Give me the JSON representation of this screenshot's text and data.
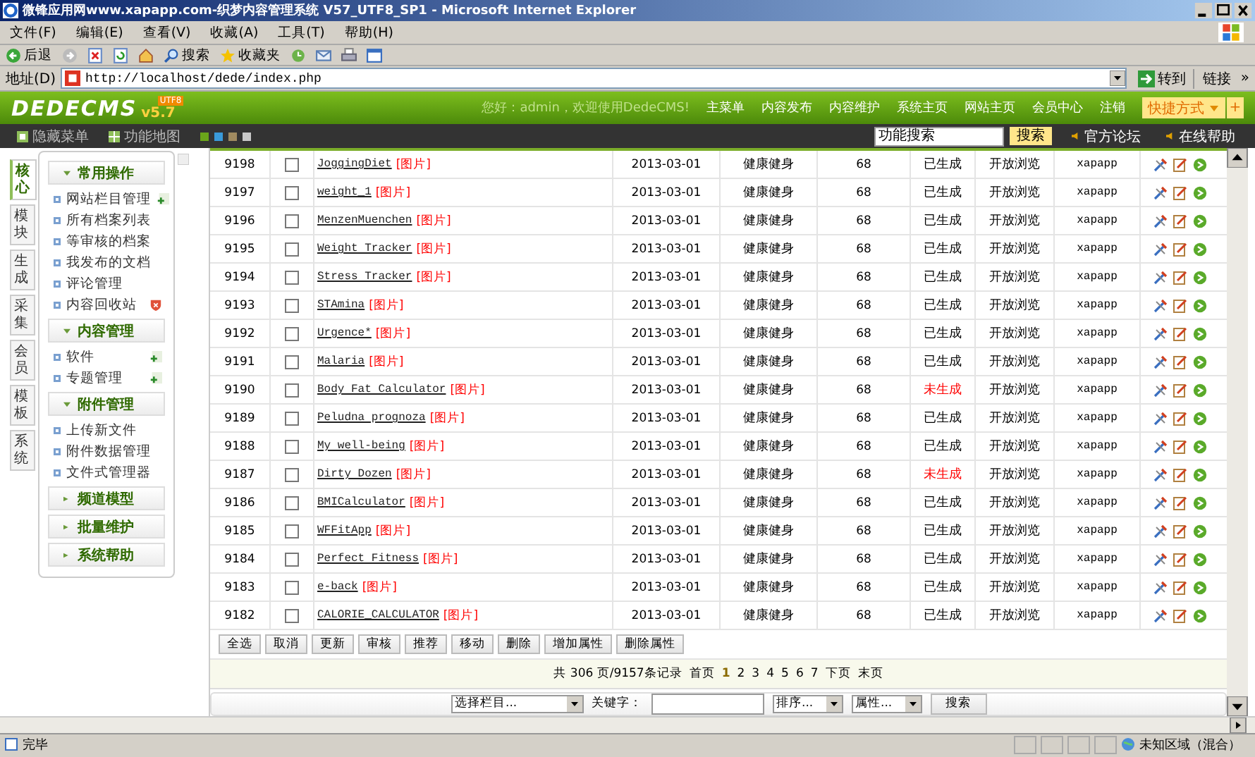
{
  "window": {
    "title": "微锋应用网www.xapapp.com-织梦内容管理系统 V57_UTF8_SP1 - Microsoft Internet Explorer"
  },
  "menu": [
    "文件(F)",
    "编辑(E)",
    "查看(V)",
    "收藏(A)",
    "工具(T)",
    "帮助(H)"
  ],
  "toolbar": [
    {
      "kind": "back",
      "label": "后退"
    },
    {
      "kind": "forward"
    },
    {
      "kind": "stop"
    },
    {
      "kind": "refresh"
    },
    {
      "kind": "home"
    },
    {
      "kind": "search",
      "label": "搜索"
    },
    {
      "kind": "favorites",
      "label": "收藏夹"
    },
    {
      "kind": "history"
    },
    {
      "kind": "mail"
    },
    {
      "kind": "print"
    },
    {
      "kind": "edit"
    }
  ],
  "address": {
    "label": "地址(D)",
    "url": "http://localhost/dede/index.php",
    "go": "转到",
    "links": "链接",
    "more": "»"
  },
  "header": {
    "logo": "DEDECMS",
    "version": "v5.7",
    "badge": "UTF8",
    "greeting": "您好：admin，欢迎使用DedeCMS!",
    "nav": [
      "主菜单",
      "内容发布",
      "内容维护",
      "系统主页",
      "网站主页",
      "会员中心",
      "注销"
    ],
    "shortcut": "快捷方式",
    "add": "+"
  },
  "subbar": {
    "hide_menu": "隐藏菜单",
    "map": "功能地图",
    "skins": [
      {
        "color": "#6aa51a"
      },
      {
        "color": "#3a9ad9"
      },
      {
        "color": "#a08a60"
      },
      {
        "color": "#c8c8c8"
      }
    ],
    "search_value": "功能搜索",
    "search_button": "搜索",
    "links": [
      "官方论坛",
      "在线帮助"
    ]
  },
  "sidebar": {
    "tabs": [
      {
        "label": "核心",
        "selected": true
      },
      {
        "label": "模块",
        "selected": false
      },
      {
        "label": "生成",
        "selected": false
      },
      {
        "label": "采集",
        "selected": false
      },
      {
        "label": "会员",
        "selected": false
      },
      {
        "label": "模板",
        "selected": false
      },
      {
        "label": "系统",
        "selected": false
      }
    ],
    "groups": [
      {
        "title": "常用操作",
        "expanded": true,
        "items": [
          {
            "label": "网站栏目管理",
            "kind": "add"
          },
          {
            "label": "所有档案列表",
            "kind": "plain"
          },
          {
            "label": "等审核的档案",
            "kind": "plain"
          },
          {
            "label": "我发布的文档",
            "kind": "plain"
          },
          {
            "label": "评论管理",
            "kind": "plain"
          },
          {
            "label": "内容回收站",
            "kind": "bin"
          }
        ]
      },
      {
        "title": "内容管理",
        "expanded": true,
        "items": [
          {
            "label": "软件",
            "kind": "add"
          },
          {
            "label": "专题管理",
            "kind": "add"
          }
        ]
      },
      {
        "title": "附件管理",
        "expanded": true,
        "items": [
          {
            "label": "上传新文件",
            "kind": "plain"
          },
          {
            "label": "附件数据管理",
            "kind": "plain"
          },
          {
            "label": "文件式管理器",
            "kind": "plain"
          }
        ]
      },
      {
        "title": "频道模型",
        "expanded": false
      },
      {
        "title": "批量维护",
        "expanded": false
      },
      {
        "title": "系统帮助",
        "expanded": false
      }
    ]
  },
  "table": {
    "rows": [
      {
        "id": "9198",
        "checked": false,
        "title": "JoggingDiet",
        "tag": "[图片]",
        "date": "2013-03-01",
        "category": "健康健身",
        "count": "68",
        "status": "已生成",
        "generated": true,
        "access": "开放浏览",
        "author": "xapapp"
      },
      {
        "id": "9197",
        "checked": false,
        "title": "weight_1",
        "tag": "[图片]",
        "date": "2013-03-01",
        "category": "健康健身",
        "count": "68",
        "status": "已生成",
        "generated": true,
        "access": "开放浏览",
        "author": "xapapp"
      },
      {
        "id": "9196",
        "checked": false,
        "title": "MenzenMuenchen",
        "tag": "[图片]",
        "date": "2013-03-01",
        "category": "健康健身",
        "count": "68",
        "status": "已生成",
        "generated": true,
        "access": "开放浏览",
        "author": "xapapp"
      },
      {
        "id": "9195",
        "checked": false,
        "title": "Weight Tracker",
        "tag": "[图片]",
        "date": "2013-03-01",
        "category": "健康健身",
        "count": "68",
        "status": "已生成",
        "generated": true,
        "access": "开放浏览",
        "author": "xapapp"
      },
      {
        "id": "9194",
        "checked": false,
        "title": "Stress Tracker",
        "tag": "[图片]",
        "date": "2013-03-01",
        "category": "健康健身",
        "count": "68",
        "status": "已生成",
        "generated": true,
        "access": "开放浏览",
        "author": "xapapp"
      },
      {
        "id": "9193",
        "checked": false,
        "title": "STAmina",
        "tag": "[图片]",
        "date": "2013-03-01",
        "category": "健康健身",
        "count": "68",
        "status": "已生成",
        "generated": true,
        "access": "开放浏览",
        "author": "xapapp"
      },
      {
        "id": "9192",
        "checked": false,
        "title": "Urgence*",
        "tag": "[图片]",
        "date": "2013-03-01",
        "category": "健康健身",
        "count": "68",
        "status": "已生成",
        "generated": true,
        "access": "开放浏览",
        "author": "xapapp"
      },
      {
        "id": "9191",
        "checked": false,
        "title": "Malaria",
        "tag": "[图片]",
        "date": "2013-03-01",
        "category": "健康健身",
        "count": "68",
        "status": "已生成",
        "generated": true,
        "access": "开放浏览",
        "author": "xapapp"
      },
      {
        "id": "9190",
        "checked": false,
        "title": "Body Fat Calculator",
        "tag": "[图片]",
        "date": "2013-03-01",
        "category": "健康健身",
        "count": "68",
        "status": "未生成",
        "generated": false,
        "access": "开放浏览",
        "author": "xapapp"
      },
      {
        "id": "9189",
        "checked": false,
        "title": "Peludna prognoza",
        "tag": "[图片]",
        "date": "2013-03-01",
        "category": "健康健身",
        "count": "68",
        "status": "已生成",
        "generated": true,
        "access": "开放浏览",
        "author": "xapapp"
      },
      {
        "id": "9188",
        "checked": false,
        "title": "My well-being",
        "tag": "[图片]",
        "date": "2013-03-01",
        "category": "健康健身",
        "count": "68",
        "status": "已生成",
        "generated": true,
        "access": "开放浏览",
        "author": "xapapp"
      },
      {
        "id": "9187",
        "checked": false,
        "title": "Dirty Dozen",
        "tag": "[图片]",
        "date": "2013-03-01",
        "category": "健康健身",
        "count": "68",
        "status": "未生成",
        "generated": false,
        "access": "开放浏览",
        "author": "xapapp"
      },
      {
        "id": "9186",
        "checked": false,
        "title": "BMICalculator",
        "tag": "[图片]",
        "date": "2013-03-01",
        "category": "健康健身",
        "count": "68",
        "status": "已生成",
        "generated": true,
        "access": "开放浏览",
        "author": "xapapp"
      },
      {
        "id": "9185",
        "checked": false,
        "title": "WFFitApp",
        "tag": "[图片]",
        "date": "2013-03-01",
        "category": "健康健身",
        "count": "68",
        "status": "已生成",
        "generated": true,
        "access": "开放浏览",
        "author": "xapapp"
      },
      {
        "id": "9184",
        "checked": false,
        "title": "Perfect Fitness",
        "tag": "[图片]",
        "date": "2013-03-01",
        "category": "健康健身",
        "count": "68",
        "status": "已生成",
        "generated": true,
        "access": "开放浏览",
        "author": "xapapp"
      },
      {
        "id": "9183",
        "checked": false,
        "title": "e-back",
        "tag": "[图片]",
        "date": "2013-03-01",
        "category": "健康健身",
        "count": "68",
        "status": "已生成",
        "generated": true,
        "access": "开放浏览",
        "author": "xapapp"
      },
      {
        "id": "9182",
        "checked": false,
        "title": "CALORIE_CALCULATOR",
        "tag": "[图片]",
        "date": "2013-03-01",
        "category": "健康健身",
        "count": "68",
        "status": "已生成",
        "generated": true,
        "access": "开放浏览",
        "author": "xapapp"
      }
    ]
  },
  "actions": [
    "全选",
    "取消",
    "更新",
    "审核",
    "推荐",
    "移动",
    "删除",
    "增加属性",
    "删除属性"
  ],
  "pagination": {
    "summary": "共 306 页/9157条记录",
    "first": "首页",
    "pages": [
      {
        "label": "1",
        "selected": true
      },
      {
        "label": "2",
        "selected": false
      },
      {
        "label": "3",
        "selected": false
      },
      {
        "label": "4",
        "selected": false
      },
      {
        "label": "5",
        "selected": false
      },
      {
        "label": "6",
        "selected": false
      },
      {
        "label": "7",
        "selected": false
      }
    ],
    "next": "下页",
    "last": "末页"
  },
  "filter": {
    "category": "选择栏目...",
    "keyword_label": "关键字：",
    "sort": "排序...",
    "attribute": "属性...",
    "button": "搜索"
  },
  "status_bar": {
    "text": "完毕",
    "zone": "未知区域（混合）"
  }
}
